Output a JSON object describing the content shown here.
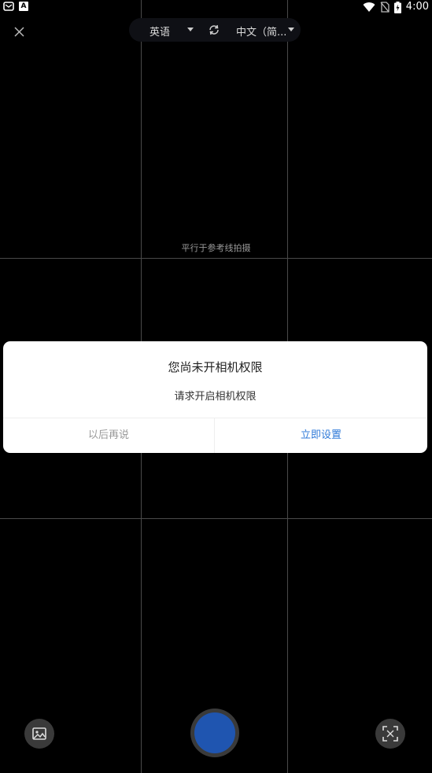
{
  "status_bar": {
    "time": "4:00",
    "left_icons": [
      "notification-icon",
      "a-icon"
    ],
    "right_icons": [
      "wifi-icon",
      "no-sim-icon",
      "battery-charging-icon"
    ],
    "a_icon_glyph": "A"
  },
  "top_bar": {
    "source_language": "英语",
    "target_language": "中文（简...",
    "close_icon": "close-icon",
    "swap_icon": "swap-icon"
  },
  "viewfinder": {
    "hint": "平行于参考线拍摄"
  },
  "dialog": {
    "title": "您尚未开相机权限",
    "message": "请求开启相机权限",
    "later_label": "以后再说",
    "settings_label": "立即设置",
    "settings_color": "#2f7ad8"
  },
  "bottom_controls": {
    "gallery_icon": "image-icon",
    "shutter_color": "#1f55b0",
    "scan_icon": "scan-icon"
  }
}
